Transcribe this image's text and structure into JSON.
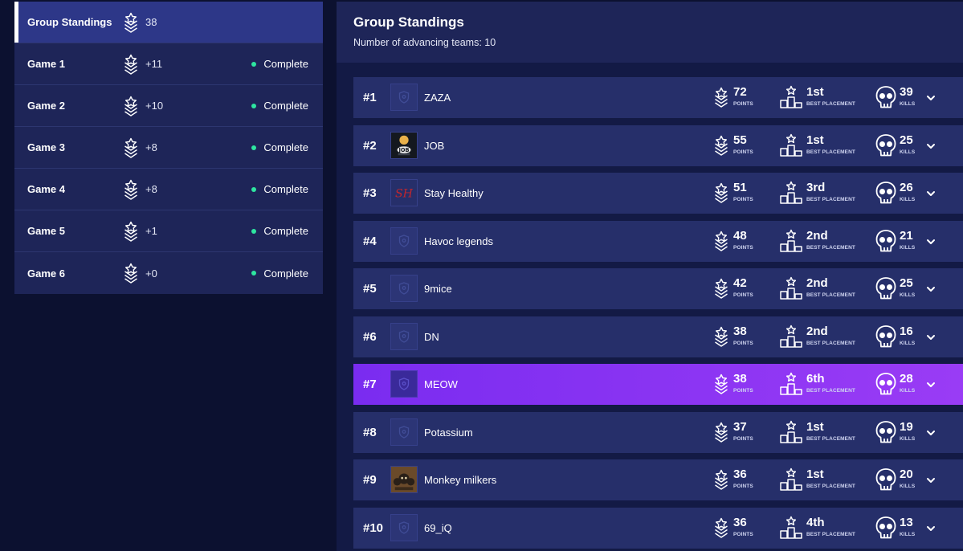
{
  "sidebar": {
    "items": [
      {
        "label": "Group Standings",
        "points": "38",
        "status": "",
        "active": true
      },
      {
        "label": "Game 1",
        "points": "+11",
        "status": "Complete"
      },
      {
        "label": "Game 2",
        "points": "+10",
        "status": "Complete"
      },
      {
        "label": "Game 3",
        "points": "+8",
        "status": "Complete"
      },
      {
        "label": "Game 4",
        "points": "+8",
        "status": "Complete"
      },
      {
        "label": "Game 5",
        "points": "+1",
        "status": "Complete"
      },
      {
        "label": "Game 6",
        "points": "+0",
        "status": "Complete"
      }
    ]
  },
  "main": {
    "title": "Group Standings",
    "subtitle": "Number of advancing teams: 10",
    "labels": {
      "points": "POINTS",
      "placement": "BEST PLACEMENT",
      "kills": "KILLS"
    },
    "standings": [
      {
        "rank": "#1",
        "team": "ZAZA",
        "logo": "shield-placeholder-icon",
        "points": "72",
        "best_placement": "1st",
        "kills": "39"
      },
      {
        "rank": "#2",
        "team": "JOB",
        "logo": "job-team-logo",
        "points": "55",
        "best_placement": "1st",
        "kills": "25"
      },
      {
        "rank": "#3",
        "team": "Stay Healthy",
        "logo": "sh-team-logo",
        "logo_text": "SH",
        "points": "51",
        "best_placement": "3rd",
        "kills": "26"
      },
      {
        "rank": "#4",
        "team": "Havoc legends",
        "logo": "shield-placeholder-icon",
        "points": "48",
        "best_placement": "2nd",
        "kills": "21"
      },
      {
        "rank": "#5",
        "team": "9mice",
        "logo": "shield-placeholder-icon",
        "points": "42",
        "best_placement": "2nd",
        "kills": "25"
      },
      {
        "rank": "#6",
        "team": "DN",
        "logo": "shield-placeholder-icon",
        "points": "38",
        "best_placement": "2nd",
        "kills": "16"
      },
      {
        "rank": "#7",
        "team": "MEOW",
        "logo": "shield-placeholder-icon",
        "points": "38",
        "best_placement": "6th",
        "kills": "28",
        "highlighted": true
      },
      {
        "rank": "#8",
        "team": "Potassium",
        "logo": "shield-placeholder-icon",
        "points": "37",
        "best_placement": "1st",
        "kills": "19"
      },
      {
        "rank": "#9",
        "team": "Monkey milkers",
        "logo": "monkey-team-logo",
        "points": "36",
        "best_placement": "1st",
        "kills": "20"
      },
      {
        "rank": "#10",
        "team": "69_iQ",
        "logo": "shield-placeholder-icon",
        "points": "36",
        "best_placement": "4th",
        "kills": "13"
      }
    ]
  },
  "colors": {
    "background": "#0c1130",
    "panel": "#1e2558",
    "row": "#262f6a",
    "active_sidebar": "#2d3788",
    "highlight_row": "#8a34f2",
    "status_dot": "#2ee6a0",
    "sh_logo_red": "#c0262d"
  }
}
